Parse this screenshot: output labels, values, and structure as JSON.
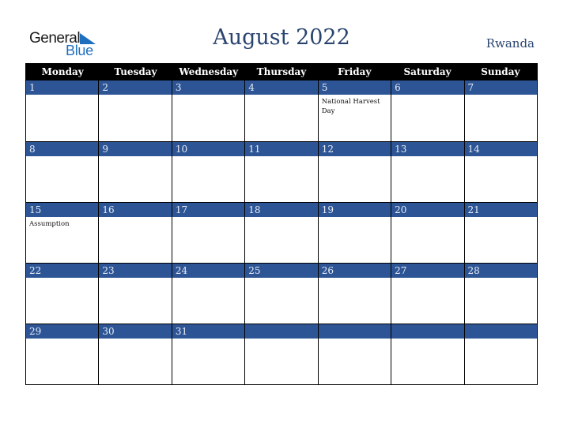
{
  "logo": {
    "general": "General",
    "blue": "Blue"
  },
  "title": "August 2022",
  "country": "Rwanda",
  "colors": {
    "band": "#2d5595",
    "header": "#000000",
    "title": "#2a4470",
    "logo_blue": "#1f6fc0"
  },
  "weekdays": [
    "Monday",
    "Tuesday",
    "Wednesday",
    "Thursday",
    "Friday",
    "Saturday",
    "Sunday"
  ],
  "weeks": [
    [
      {
        "d": "1",
        "e": ""
      },
      {
        "d": "2",
        "e": ""
      },
      {
        "d": "3",
        "e": ""
      },
      {
        "d": "4",
        "e": ""
      },
      {
        "d": "5",
        "e": "National Harvest Day"
      },
      {
        "d": "6",
        "e": ""
      },
      {
        "d": "7",
        "e": ""
      }
    ],
    [
      {
        "d": "8",
        "e": ""
      },
      {
        "d": "9",
        "e": ""
      },
      {
        "d": "10",
        "e": ""
      },
      {
        "d": "11",
        "e": ""
      },
      {
        "d": "12",
        "e": ""
      },
      {
        "d": "13",
        "e": ""
      },
      {
        "d": "14",
        "e": ""
      }
    ],
    [
      {
        "d": "15",
        "e": "Assumption"
      },
      {
        "d": "16",
        "e": ""
      },
      {
        "d": "17",
        "e": ""
      },
      {
        "d": "18",
        "e": ""
      },
      {
        "d": "19",
        "e": ""
      },
      {
        "d": "20",
        "e": ""
      },
      {
        "d": "21",
        "e": ""
      }
    ],
    [
      {
        "d": "22",
        "e": ""
      },
      {
        "d": "23",
        "e": ""
      },
      {
        "d": "24",
        "e": ""
      },
      {
        "d": "25",
        "e": ""
      },
      {
        "d": "26",
        "e": ""
      },
      {
        "d": "27",
        "e": ""
      },
      {
        "d": "28",
        "e": ""
      }
    ],
    [
      {
        "d": "29",
        "e": ""
      },
      {
        "d": "30",
        "e": ""
      },
      {
        "d": "31",
        "e": ""
      },
      {
        "d": "",
        "e": ""
      },
      {
        "d": "",
        "e": ""
      },
      {
        "d": "",
        "e": ""
      },
      {
        "d": "",
        "e": ""
      }
    ]
  ]
}
